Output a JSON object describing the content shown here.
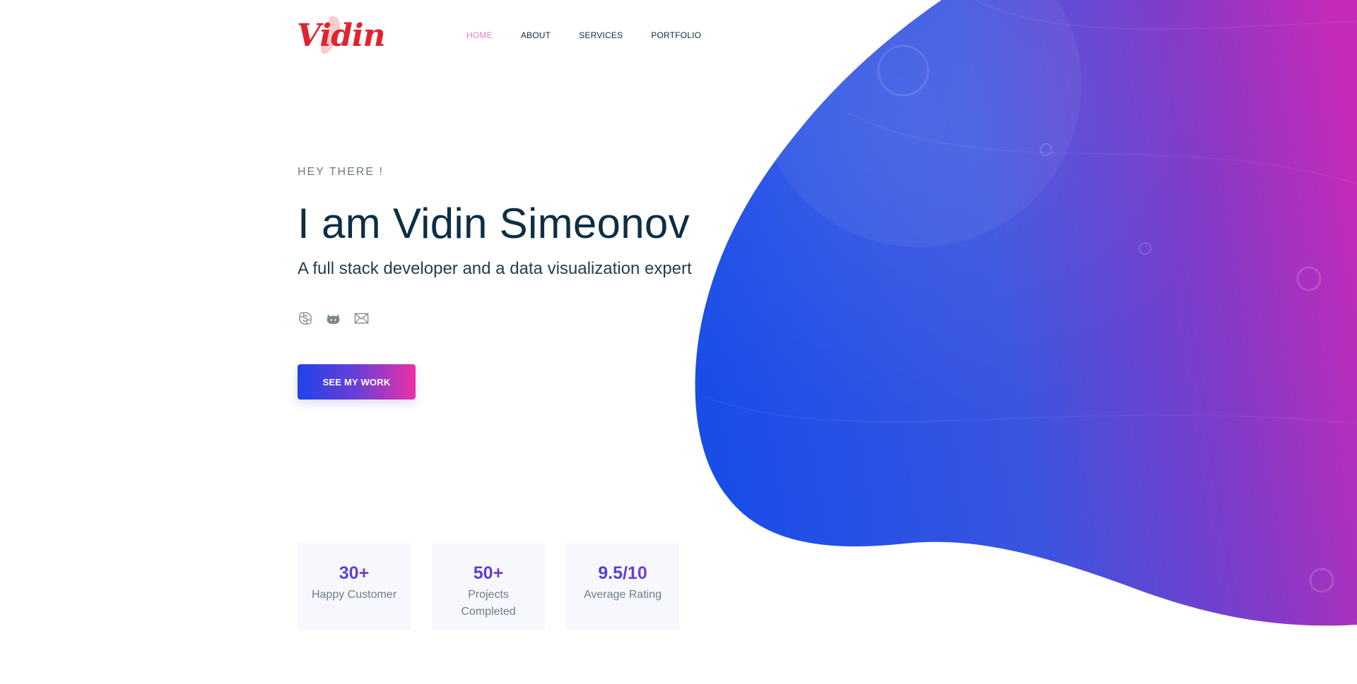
{
  "brand": {
    "logo_text": "Vidin",
    "logo_color": "#e0242f"
  },
  "nav": {
    "items": [
      {
        "label": "HOME",
        "active": true
      },
      {
        "label": "ABOUT",
        "active": false
      },
      {
        "label": "SERVICES",
        "active": false
      },
      {
        "label": "PORTFOLIO",
        "active": false
      }
    ],
    "active_color": "#ea7cc1"
  },
  "hero": {
    "eyebrow": "HEY THERE !",
    "headline": "I am Vidin Simeonov",
    "subline": "A full stack developer and a data visualization expert",
    "socials": [
      {
        "icon": "skype-icon"
      },
      {
        "icon": "github-icon"
      },
      {
        "icon": "mail-icon"
      }
    ],
    "cta_label": "SEE MY WORK"
  },
  "stats": [
    {
      "value": "30+",
      "label": "Happy Customer"
    },
    {
      "value": "50+",
      "label": "Projects Completed"
    },
    {
      "value": "9.5/10",
      "label": "Average Rating"
    }
  ],
  "colors": {
    "accent_blue": "#1f43e8",
    "accent_purple": "#7a3bd0",
    "accent_pink": "#ea31a6",
    "heading": "#0e2e43"
  }
}
